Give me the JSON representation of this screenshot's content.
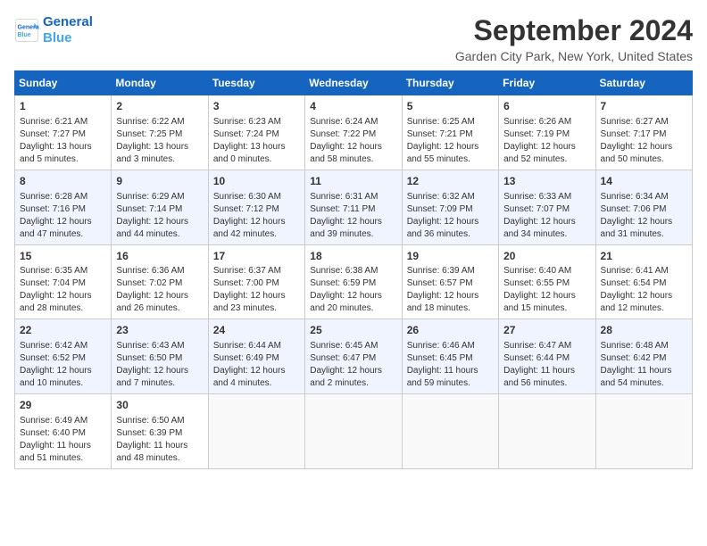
{
  "logo": {
    "line1": "General",
    "line2": "Blue"
  },
  "title": "September 2024",
  "subtitle": "Garden City Park, New York, United States",
  "headers": [
    "Sunday",
    "Monday",
    "Tuesday",
    "Wednesday",
    "Thursday",
    "Friday",
    "Saturday"
  ],
  "weeks": [
    [
      {
        "day": "1",
        "info": "Sunrise: 6:21 AM\nSunset: 7:27 PM\nDaylight: 13 hours\nand 5 minutes."
      },
      {
        "day": "2",
        "info": "Sunrise: 6:22 AM\nSunset: 7:25 PM\nDaylight: 13 hours\nand 3 minutes."
      },
      {
        "day": "3",
        "info": "Sunrise: 6:23 AM\nSunset: 7:24 PM\nDaylight: 13 hours\nand 0 minutes."
      },
      {
        "day": "4",
        "info": "Sunrise: 6:24 AM\nSunset: 7:22 PM\nDaylight: 12 hours\nand 58 minutes."
      },
      {
        "day": "5",
        "info": "Sunrise: 6:25 AM\nSunset: 7:21 PM\nDaylight: 12 hours\nand 55 minutes."
      },
      {
        "day": "6",
        "info": "Sunrise: 6:26 AM\nSunset: 7:19 PM\nDaylight: 12 hours\nand 52 minutes."
      },
      {
        "day": "7",
        "info": "Sunrise: 6:27 AM\nSunset: 7:17 PM\nDaylight: 12 hours\nand 50 minutes."
      }
    ],
    [
      {
        "day": "8",
        "info": "Sunrise: 6:28 AM\nSunset: 7:16 PM\nDaylight: 12 hours\nand 47 minutes."
      },
      {
        "day": "9",
        "info": "Sunrise: 6:29 AM\nSunset: 7:14 PM\nDaylight: 12 hours\nand 44 minutes."
      },
      {
        "day": "10",
        "info": "Sunrise: 6:30 AM\nSunset: 7:12 PM\nDaylight: 12 hours\nand 42 minutes."
      },
      {
        "day": "11",
        "info": "Sunrise: 6:31 AM\nSunset: 7:11 PM\nDaylight: 12 hours\nand 39 minutes."
      },
      {
        "day": "12",
        "info": "Sunrise: 6:32 AM\nSunset: 7:09 PM\nDaylight: 12 hours\nand 36 minutes."
      },
      {
        "day": "13",
        "info": "Sunrise: 6:33 AM\nSunset: 7:07 PM\nDaylight: 12 hours\nand 34 minutes."
      },
      {
        "day": "14",
        "info": "Sunrise: 6:34 AM\nSunset: 7:06 PM\nDaylight: 12 hours\nand 31 minutes."
      }
    ],
    [
      {
        "day": "15",
        "info": "Sunrise: 6:35 AM\nSunset: 7:04 PM\nDaylight: 12 hours\nand 28 minutes."
      },
      {
        "day": "16",
        "info": "Sunrise: 6:36 AM\nSunset: 7:02 PM\nDaylight: 12 hours\nand 26 minutes."
      },
      {
        "day": "17",
        "info": "Sunrise: 6:37 AM\nSunset: 7:00 PM\nDaylight: 12 hours\nand 23 minutes."
      },
      {
        "day": "18",
        "info": "Sunrise: 6:38 AM\nSunset: 6:59 PM\nDaylight: 12 hours\nand 20 minutes."
      },
      {
        "day": "19",
        "info": "Sunrise: 6:39 AM\nSunset: 6:57 PM\nDaylight: 12 hours\nand 18 minutes."
      },
      {
        "day": "20",
        "info": "Sunrise: 6:40 AM\nSunset: 6:55 PM\nDaylight: 12 hours\nand 15 minutes."
      },
      {
        "day": "21",
        "info": "Sunrise: 6:41 AM\nSunset: 6:54 PM\nDaylight: 12 hours\nand 12 minutes."
      }
    ],
    [
      {
        "day": "22",
        "info": "Sunrise: 6:42 AM\nSunset: 6:52 PM\nDaylight: 12 hours\nand 10 minutes."
      },
      {
        "day": "23",
        "info": "Sunrise: 6:43 AM\nSunset: 6:50 PM\nDaylight: 12 hours\nand 7 minutes."
      },
      {
        "day": "24",
        "info": "Sunrise: 6:44 AM\nSunset: 6:49 PM\nDaylight: 12 hours\nand 4 minutes."
      },
      {
        "day": "25",
        "info": "Sunrise: 6:45 AM\nSunset: 6:47 PM\nDaylight: 12 hours\nand 2 minutes."
      },
      {
        "day": "26",
        "info": "Sunrise: 6:46 AM\nSunset: 6:45 PM\nDaylight: 11 hours\nand 59 minutes."
      },
      {
        "day": "27",
        "info": "Sunrise: 6:47 AM\nSunset: 6:44 PM\nDaylight: 11 hours\nand 56 minutes."
      },
      {
        "day": "28",
        "info": "Sunrise: 6:48 AM\nSunset: 6:42 PM\nDaylight: 11 hours\nand 54 minutes."
      }
    ],
    [
      {
        "day": "29",
        "info": "Sunrise: 6:49 AM\nSunset: 6:40 PM\nDaylight: 11 hours\nand 51 minutes."
      },
      {
        "day": "30",
        "info": "Sunrise: 6:50 AM\nSunset: 6:39 PM\nDaylight: 11 hours\nand 48 minutes."
      },
      {
        "day": "",
        "info": ""
      },
      {
        "day": "",
        "info": ""
      },
      {
        "day": "",
        "info": ""
      },
      {
        "day": "",
        "info": ""
      },
      {
        "day": "",
        "info": ""
      }
    ]
  ]
}
